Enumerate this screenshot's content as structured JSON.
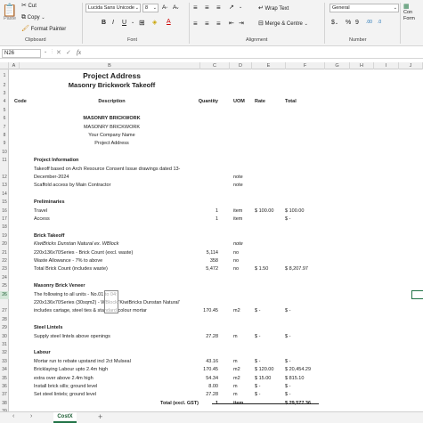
{
  "ribbon": {
    "paste_label": "Paste",
    "cut_label": "Cut",
    "copy_label": "Copy",
    "format_painter_label": "Format Painter",
    "font_name": "Lucida Sans Unicode",
    "font_size": "8",
    "wrap_text_label": "Wrap Text",
    "merge_label": "Merge & Centre",
    "number_format": "General",
    "cond_label": "Con",
    "form_label": "Form",
    "groups": {
      "clipboard": "Clipboard",
      "font": "Font",
      "alignment": "Alignment",
      "number": "Number"
    },
    "bold": "B",
    "italic": "I",
    "underline": "U"
  },
  "formula_bar": {
    "cell_ref": "N26",
    "fx": "fx",
    "value": ""
  },
  "columns": [
    "A",
    "B",
    "C",
    "D",
    "E",
    "F",
    "G",
    "H",
    "I",
    "J"
  ],
  "rows": [
    {
      "n": "1",
      "cells": [
        {
          "col": "B",
          "text": "Project Address",
          "style": "t1 ctr"
        }
      ]
    },
    {
      "n": "2",
      "cells": [
        {
          "col": "B",
          "text": "Masonry Brickwork Takeoff",
          "style": "t2 ctr"
        }
      ]
    },
    {
      "n": "3",
      "cells": []
    },
    {
      "n": "4",
      "cells": [
        {
          "col": "A",
          "text": "Code",
          "style": "b"
        },
        {
          "col": "B",
          "text": "Description",
          "style": "b ctr"
        },
        {
          "col": "C",
          "text": "Quantity",
          "style": "b r"
        },
        {
          "col": "D",
          "text": "UOM",
          "style": "b"
        },
        {
          "col": "E",
          "text": "Rate",
          "style": "b"
        },
        {
          "col": "F",
          "text": "Total",
          "style": "b"
        }
      ]
    },
    {
      "n": "5",
      "cells": []
    },
    {
      "n": "6",
      "cells": [
        {
          "col": "B",
          "text": "MASONRY BRICKWORK",
          "style": "b ctr"
        }
      ]
    },
    {
      "n": "7",
      "cells": [
        {
          "col": "B",
          "text": "MASONRY BRICKWORK",
          "style": "ctr"
        }
      ]
    },
    {
      "n": "8",
      "cells": [
        {
          "col": "B",
          "text": "Your Company Name",
          "style": "ctr"
        }
      ]
    },
    {
      "n": "9",
      "cells": [
        {
          "col": "B",
          "text": "Project Address",
          "style": "ctr"
        }
      ]
    },
    {
      "n": "10",
      "cells": []
    },
    {
      "n": "11",
      "cells": [
        {
          "col": "B",
          "text": "Project Information",
          "style": "b"
        }
      ]
    },
    {
      "n": "12a",
      "cells": [
        {
          "col": "B",
          "text": "Takeoff based on Arch Resource Consent Issue drawings dated 13-",
          "style": ""
        }
      ]
    },
    {
      "n": "12",
      "cells": [
        {
          "col": "B",
          "text": "December-2024",
          "style": ""
        },
        {
          "col": "D",
          "text": "note",
          "style": ""
        }
      ]
    },
    {
      "n": "13",
      "cells": [
        {
          "col": "B",
          "text": "Scaffold access by Main Contractor",
          "style": ""
        },
        {
          "col": "D",
          "text": "note",
          "style": ""
        }
      ]
    },
    {
      "n": "14",
      "cells": []
    },
    {
      "n": "15",
      "cells": [
        {
          "col": "B",
          "text": "Preliminaries",
          "style": "b"
        }
      ]
    },
    {
      "n": "16",
      "cells": [
        {
          "col": "B",
          "text": "Travel",
          "style": ""
        },
        {
          "col": "C",
          "text": "1",
          "style": "r"
        },
        {
          "col": "D",
          "text": "item",
          "style": ""
        },
        {
          "col": "E",
          "text": "$ 100.00",
          "style": ""
        },
        {
          "col": "F",
          "text": "$        100.00",
          "style": ""
        }
      ]
    },
    {
      "n": "17",
      "cells": [
        {
          "col": "B",
          "text": "Access",
          "style": ""
        },
        {
          "col": "C",
          "text": "1",
          "style": "r"
        },
        {
          "col": "D",
          "text": "item",
          "style": ""
        },
        {
          "col": "F",
          "text": "$              -",
          "style": ""
        }
      ]
    },
    {
      "n": "18",
      "cells": []
    },
    {
      "n": "19",
      "cells": [
        {
          "col": "B",
          "text": "Brick Takeoff",
          "style": "b"
        }
      ]
    },
    {
      "n": "20",
      "cells": [
        {
          "col": "B",
          "text": "KiwiBricks Dunstan Natural ex. WBlock",
          "style": "i"
        },
        {
          "col": "D",
          "text": "note",
          "style": "i"
        }
      ]
    },
    {
      "n": "21",
      "cells": [
        {
          "col": "B",
          "text": "220x136x70Series - Brick Count (excl. waste)",
          "style": ""
        },
        {
          "col": "C",
          "text": "5,114",
          "style": "r"
        },
        {
          "col": "D",
          "text": "no",
          "style": ""
        }
      ]
    },
    {
      "n": "22",
      "cells": [
        {
          "col": "B",
          "text": "Waste Allowance - 7% to above",
          "style": ""
        },
        {
          "col": "C",
          "text": "358",
          "style": "r"
        },
        {
          "col": "D",
          "text": "no",
          "style": ""
        }
      ]
    },
    {
      "n": "23",
      "cells": [
        {
          "col": "B",
          "text": "Total Brick Count (includes waste)",
          "style": ""
        },
        {
          "col": "C",
          "text": "5,472",
          "style": "r"
        },
        {
          "col": "D",
          "text": "no",
          "style": ""
        },
        {
          "col": "E",
          "text": "$   1.50",
          "style": ""
        },
        {
          "col": "F",
          "text": "$    8,207.97",
          "style": ""
        }
      ]
    },
    {
      "n": "24",
      "cells": []
    },
    {
      "n": "25",
      "cells": [
        {
          "col": "B",
          "text": "Masonry Brick Veneer",
          "style": "b"
        }
      ]
    },
    {
      "n": "26",
      "cells": [
        {
          "col": "B",
          "text": "The following to all units - No.01 to 04:",
          "style": ""
        }
      ]
    },
    {
      "n": "27a",
      "cells": [
        {
          "col": "B",
          "text": "220x136x70Series (30sqm2) - WBlock 'KiwiBricks Dunstan Natural'",
          "style": ""
        }
      ]
    },
    {
      "n": "27",
      "cells": [
        {
          "col": "B",
          "text": "includes cartage, steel ties & standard colour mortar",
          "style": ""
        },
        {
          "col": "C",
          "text": "170.45",
          "style": "r"
        },
        {
          "col": "D",
          "text": "m2",
          "style": ""
        },
        {
          "col": "E",
          "text": "$      -",
          "style": ""
        },
        {
          "col": "F",
          "text": "$              -",
          "style": ""
        }
      ]
    },
    {
      "n": "28",
      "cells": []
    },
    {
      "n": "29",
      "cells": [
        {
          "col": "B",
          "text": "Steel Lintels",
          "style": "b"
        }
      ]
    },
    {
      "n": "30",
      "cells": [
        {
          "col": "B",
          "text": "Supply steel lintels above openings",
          "style": ""
        },
        {
          "col": "C",
          "text": "27.28",
          "style": "r"
        },
        {
          "col": "D",
          "text": "m",
          "style": ""
        },
        {
          "col": "E",
          "text": "$      -",
          "style": ""
        },
        {
          "col": "F",
          "text": "$              -",
          "style": ""
        }
      ]
    },
    {
      "n": "31",
      "cells": []
    },
    {
      "n": "32",
      "cells": [
        {
          "col": "B",
          "text": "Labour",
          "style": "b"
        }
      ]
    },
    {
      "n": "33",
      "cells": [
        {
          "col": "B",
          "text": "Mortar run to rebate upstand incl 2ct Mulseal",
          "style": ""
        },
        {
          "col": "C",
          "text": "43.16",
          "style": "r"
        },
        {
          "col": "D",
          "text": "m",
          "style": ""
        },
        {
          "col": "E",
          "text": "$      -",
          "style": ""
        },
        {
          "col": "F",
          "text": "$              -",
          "style": ""
        }
      ]
    },
    {
      "n": "34",
      "cells": [
        {
          "col": "B",
          "text": "Bricklaying Labour upto 2.4m high",
          "style": ""
        },
        {
          "col": "C",
          "text": "170.45",
          "style": "r"
        },
        {
          "col": "D",
          "text": "m2",
          "style": ""
        },
        {
          "col": "E",
          "text": "$ 120.00",
          "style": ""
        },
        {
          "col": "F",
          "text": "$   20,454.29",
          "style": ""
        }
      ]
    },
    {
      "n": "35",
      "cells": [
        {
          "col": "B",
          "text": "extra over above 2.4m high",
          "style": ""
        },
        {
          "col": "C",
          "text": "54.34",
          "style": "r"
        },
        {
          "col": "D",
          "text": "m2",
          "style": ""
        },
        {
          "col": "E",
          "text": "$  15.00",
          "style": ""
        },
        {
          "col": "F",
          "text": "$        815.10",
          "style": ""
        }
      ]
    },
    {
      "n": "36",
      "cells": [
        {
          "col": "B",
          "text": "Install brick sills; ground level",
          "style": ""
        },
        {
          "col": "C",
          "text": "8.00",
          "style": "r"
        },
        {
          "col": "D",
          "text": "m",
          "style": ""
        },
        {
          "col": "E",
          "text": "$      -",
          "style": ""
        },
        {
          "col": "F",
          "text": "$              -",
          "style": ""
        }
      ]
    },
    {
      "n": "37",
      "cells": [
        {
          "col": "B",
          "text": "Set steel lintels; ground level",
          "style": ""
        },
        {
          "col": "C",
          "text": "27.28",
          "style": "r"
        },
        {
          "col": "D",
          "text": "m",
          "style": ""
        },
        {
          "col": "E",
          "text": "$      -",
          "style": ""
        },
        {
          "col": "F",
          "text": "$              -",
          "style": ""
        }
      ]
    },
    {
      "n": "38",
      "cells": [
        {
          "col": "B",
          "text": "Total (excl. GST)",
          "style": "b r"
        },
        {
          "col": "C",
          "text": "1",
          "style": "b r"
        },
        {
          "col": "D",
          "text": "item",
          "style": "b"
        },
        {
          "col": "F",
          "text": "$  29,577.36",
          "style": "b"
        }
      ]
    },
    {
      "n": "39",
      "cells": []
    }
  ],
  "sheet_tabs": {
    "active": "CostX",
    "add": "+"
  }
}
